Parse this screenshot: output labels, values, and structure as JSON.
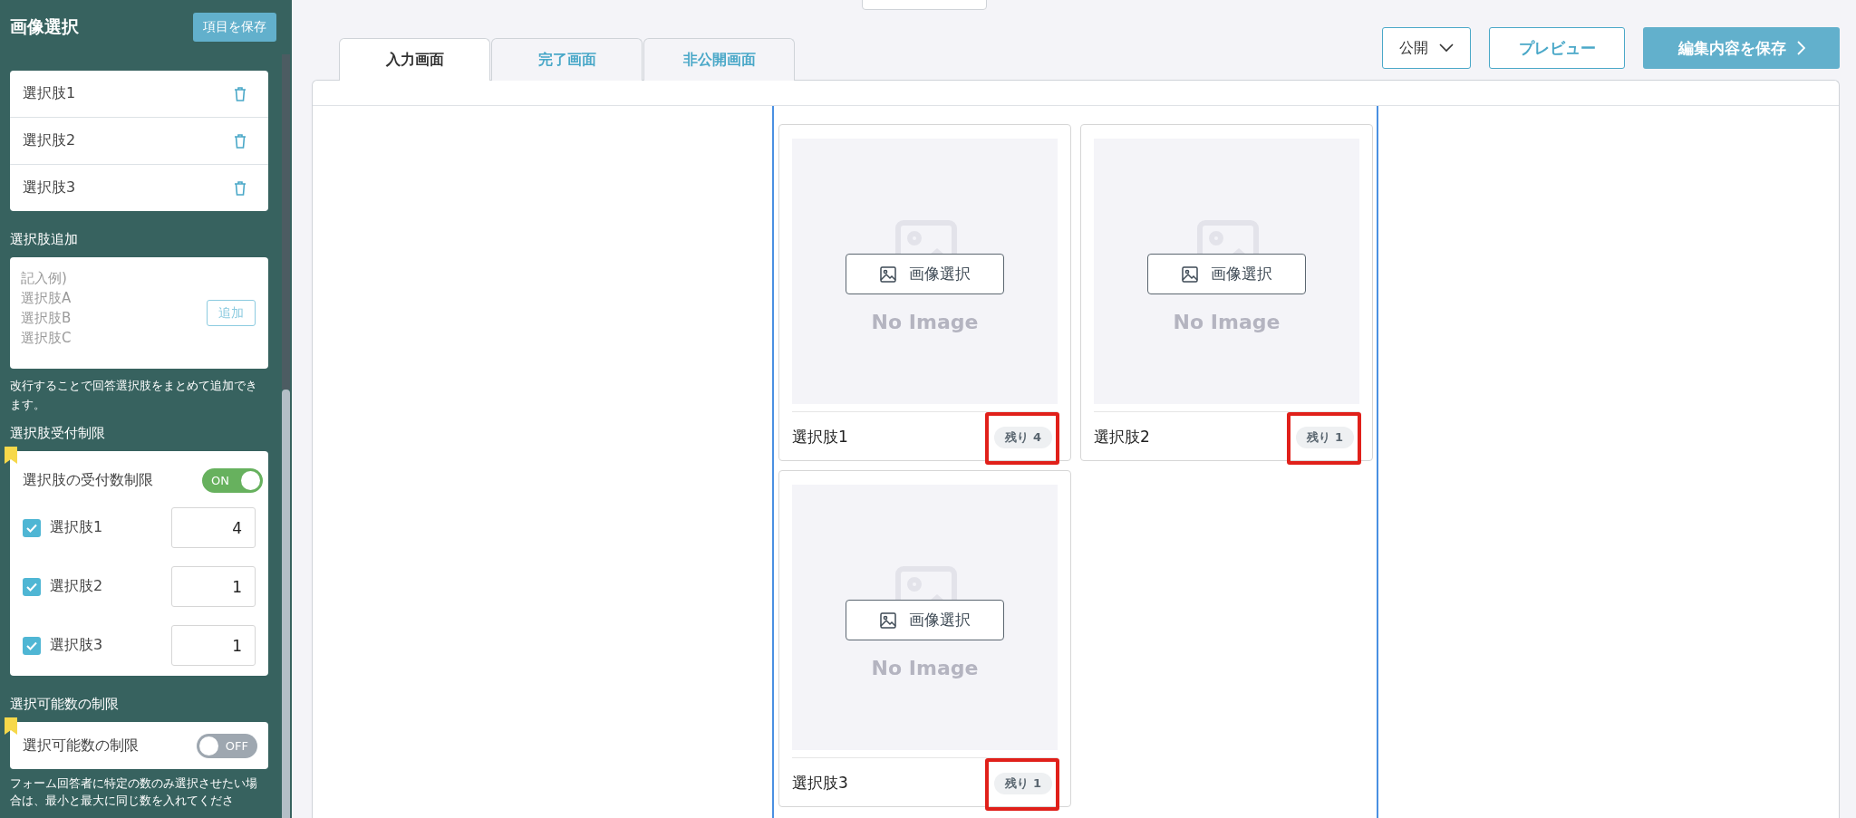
{
  "sidebar": {
    "title": "画像選択",
    "save_button": "項目を保存",
    "choices": [
      {
        "label": "選択肢1"
      },
      {
        "label": "選択肢2"
      },
      {
        "label": "選択肢3"
      }
    ],
    "add_section": {
      "label": "選択肢追加",
      "placeholder": "記入例)\n選択肢A\n選択肢B\n選択肢C",
      "add_button": "追加",
      "help": "改行することで回答選択肢をまとめて追加できます。"
    },
    "limit_section": {
      "label": "選択肢受付制限",
      "toggle_label": "選択肢の受付数制限",
      "toggle": {
        "on": true,
        "text": "ON"
      },
      "rows": [
        {
          "label": "選択肢1",
          "checked": true,
          "value": "4"
        },
        {
          "label": "選択肢2",
          "checked": true,
          "value": "1"
        },
        {
          "label": "選択肢3",
          "checked": true,
          "value": "1"
        }
      ]
    },
    "count_section": {
      "label": "選択可能数の制限",
      "toggle_label": "選択可能数の制限",
      "toggle": {
        "on": false,
        "text": "OFF"
      },
      "help": "フォーム回答者に特定の数のみ選択させたい場合は、最小と最大に同じ数を入れてくださ"
    }
  },
  "main": {
    "tabs": [
      {
        "label": "入力画面",
        "selected": true
      },
      {
        "label": "完了画面",
        "selected": false
      },
      {
        "label": "非公開画面",
        "selected": false
      }
    ],
    "visibility": "公開",
    "preview_button": "プレビュー",
    "save_button": "編集内容を保存",
    "cards": [
      {
        "label": "選択肢1",
        "button": "画像選択",
        "placeholder_text": "No Image",
        "badge": "残り 4",
        "highlighted": true
      },
      {
        "label": "選択肢2",
        "button": "画像選択",
        "placeholder_text": "No Image",
        "badge": "残り 1",
        "highlighted": true
      },
      {
        "label": "選択肢3",
        "button": "画像選択",
        "placeholder_text": "No Image",
        "badge": "残り 1",
        "highlighted": true
      }
    ]
  }
}
